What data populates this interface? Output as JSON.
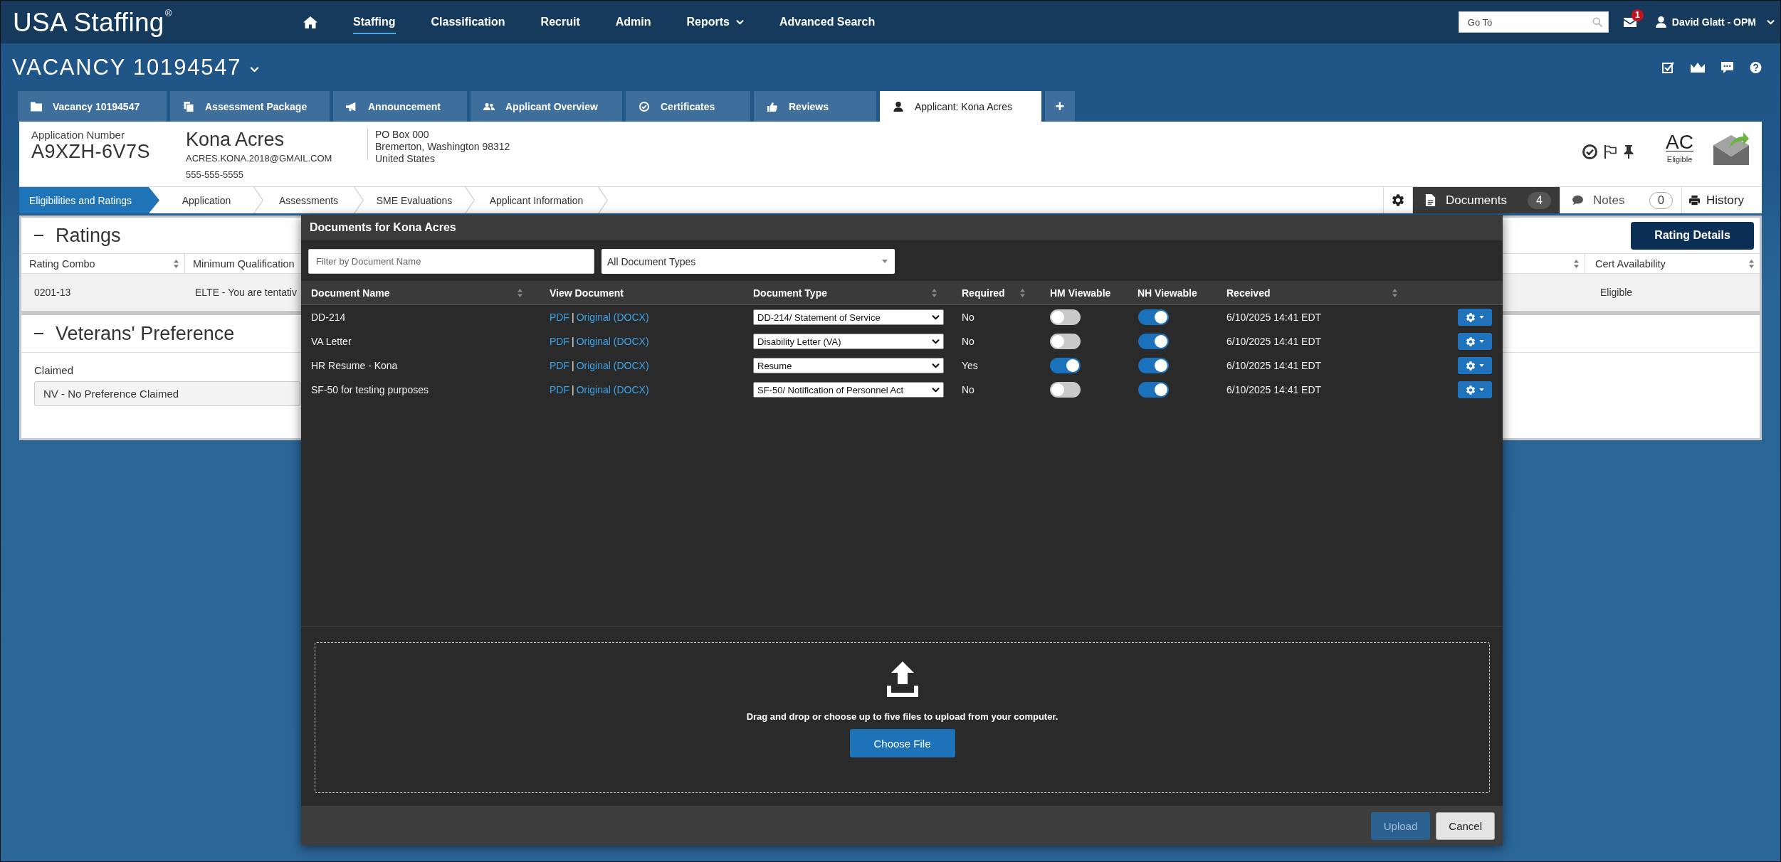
{
  "top_bar": {
    "logo": "USA Staffing$^{®}$",
    "nav": [
      {
        "kind": "home",
        "selected": false
      },
      {
        "kind": "link",
        "label": "Staffing",
        "selected": true
      },
      {
        "kind": "link",
        "label": "Classification",
        "selected": false
      },
      {
        "kind": "link",
        "label": "Recruit",
        "selected": false
      },
      {
        "kind": "link",
        "label": "Admin",
        "selected": false
      },
      {
        "kind": "menu",
        "label": "Reports",
        "selected": false
      },
      {
        "kind": "link",
        "label": "Advanced Search",
        "selected": false
      }
    ],
    "search": {
      "placeholder": "Go To"
    },
    "messages": {
      "badge": "1"
    },
    "user": {
      "name": "David Glatt - OPM"
    }
  },
  "vacancy": {
    "title": "VACANCY 10194547"
  },
  "tabs": [
    {
      "label": "Vacancy 10194547",
      "selected": false
    },
    {
      "label": "Assessment Package",
      "selected": false
    },
    {
      "label": "Announcement",
      "selected": false
    },
    {
      "label": "Applicant Overview",
      "selected": false
    },
    {
      "label": "Certificates",
      "selected": false
    },
    {
      "label": "Reviews",
      "selected": false
    },
    {
      "label": "Applicant: Kona Acres",
      "selected": true
    }
  ],
  "add_tab": "+",
  "applicant": {
    "number_label": "Application Number",
    "number": "A9XZH-6V7S",
    "name": "Kona Acres",
    "email": "ACRES.KONA.2018@GMAIL.COM",
    "phone": "555-555-5555",
    "address": [
      "PO Box 000",
      "Bremerton, Washington 98312",
      "United States"
    ],
    "status_code": "AC",
    "status": "Eligible"
  },
  "steps": [
    {
      "label": "Eligibilities and Ratings",
      "selected": true
    },
    {
      "label": "Application",
      "selected": false
    },
    {
      "label": "Assessments",
      "selected": false
    },
    {
      "label": "SME Evaluations",
      "selected": false
    },
    {
      "label": "Applicant Information",
      "selected": false
    }
  ],
  "panel_tabs": [
    {
      "label": "Documents",
      "count": "4",
      "selected": true
    },
    {
      "label": "Notes",
      "count": "0",
      "selected": false
    },
    {
      "label": "History",
      "selected": false
    }
  ],
  "ratings": {
    "title": "Ratings",
    "button": "Rating Details",
    "columns": [
      "Rating Combo",
      "Minimum Qualification",
      "Cert Availability"
    ],
    "rows": [
      [
        "0201-13",
        "ELTE - You are tentativ",
        "Eligible"
      ]
    ]
  },
  "veterans_preference": {
    "title": "Veterans' Preference",
    "label": "Claimed",
    "value": "NV - No Preference Claimed"
  },
  "documents_dialog": {
    "title": "Documents for Kona Acres",
    "filter": {
      "placeholder": "Filter by Document Name"
    },
    "type_filter": {
      "value": "All Document Types"
    },
    "columns": [
      {
        "label": "Document Name",
        "sortable": true
      },
      {
        "label": "View Document",
        "sortable": false
      },
      {
        "label": "Document Type",
        "sortable": true
      },
      {
        "label": "Required",
        "sortable": true
      },
      {
        "label": "HM Viewable",
        "sortable": false
      },
      {
        "label": "NH Viewable",
        "sortable": false
      },
      {
        "label": "Received",
        "sortable": true
      }
    ],
    "rows": [
      {
        "name": "DD-214",
        "pdf": "PDF",
        "separator": "|",
        "original": "Original (DOCX)",
        "type": "DD-214/ Statement of Service",
        "required": "No",
        "hm_viewable": false,
        "nh_viewable": true,
        "received": "6/10/2025 14:41 EDT"
      },
      {
        "name": "VA Letter",
        "pdf": "PDF",
        "separator": "|",
        "original": "Original (DOCX)",
        "type": "Disability Letter (VA)",
        "required": "No",
        "hm_viewable": false,
        "nh_viewable": true,
        "received": "6/10/2025 14:41 EDT"
      },
      {
        "name": "HR Resume - Kona",
        "pdf": "PDF",
        "separator": "|",
        "original": "Original (DOCX)",
        "type": "Resume",
        "required": "Yes",
        "hm_viewable": true,
        "nh_viewable": true,
        "received": "6/10/2025 14:41 EDT"
      },
      {
        "name": "SF-50 for testing purposes",
        "pdf": "PDF",
        "separator": "|",
        "original": "Original (DOCX)",
        "type": "SF-50/ Notification of Personnel Act",
        "required": "No",
        "hm_viewable": false,
        "nh_viewable": true,
        "received": "6/10/2025 14:41 EDT"
      }
    ],
    "dropzone": {
      "text": "Drag and drop or choose up to five files to upload from your computer.",
      "button": "Choose File"
    },
    "buttons": [
      {
        "label": "Upload",
        "kind": "primary",
        "disabled": true
      },
      {
        "label": "Cancel",
        "kind": "secondary",
        "disabled": false
      }
    ]
  }
}
